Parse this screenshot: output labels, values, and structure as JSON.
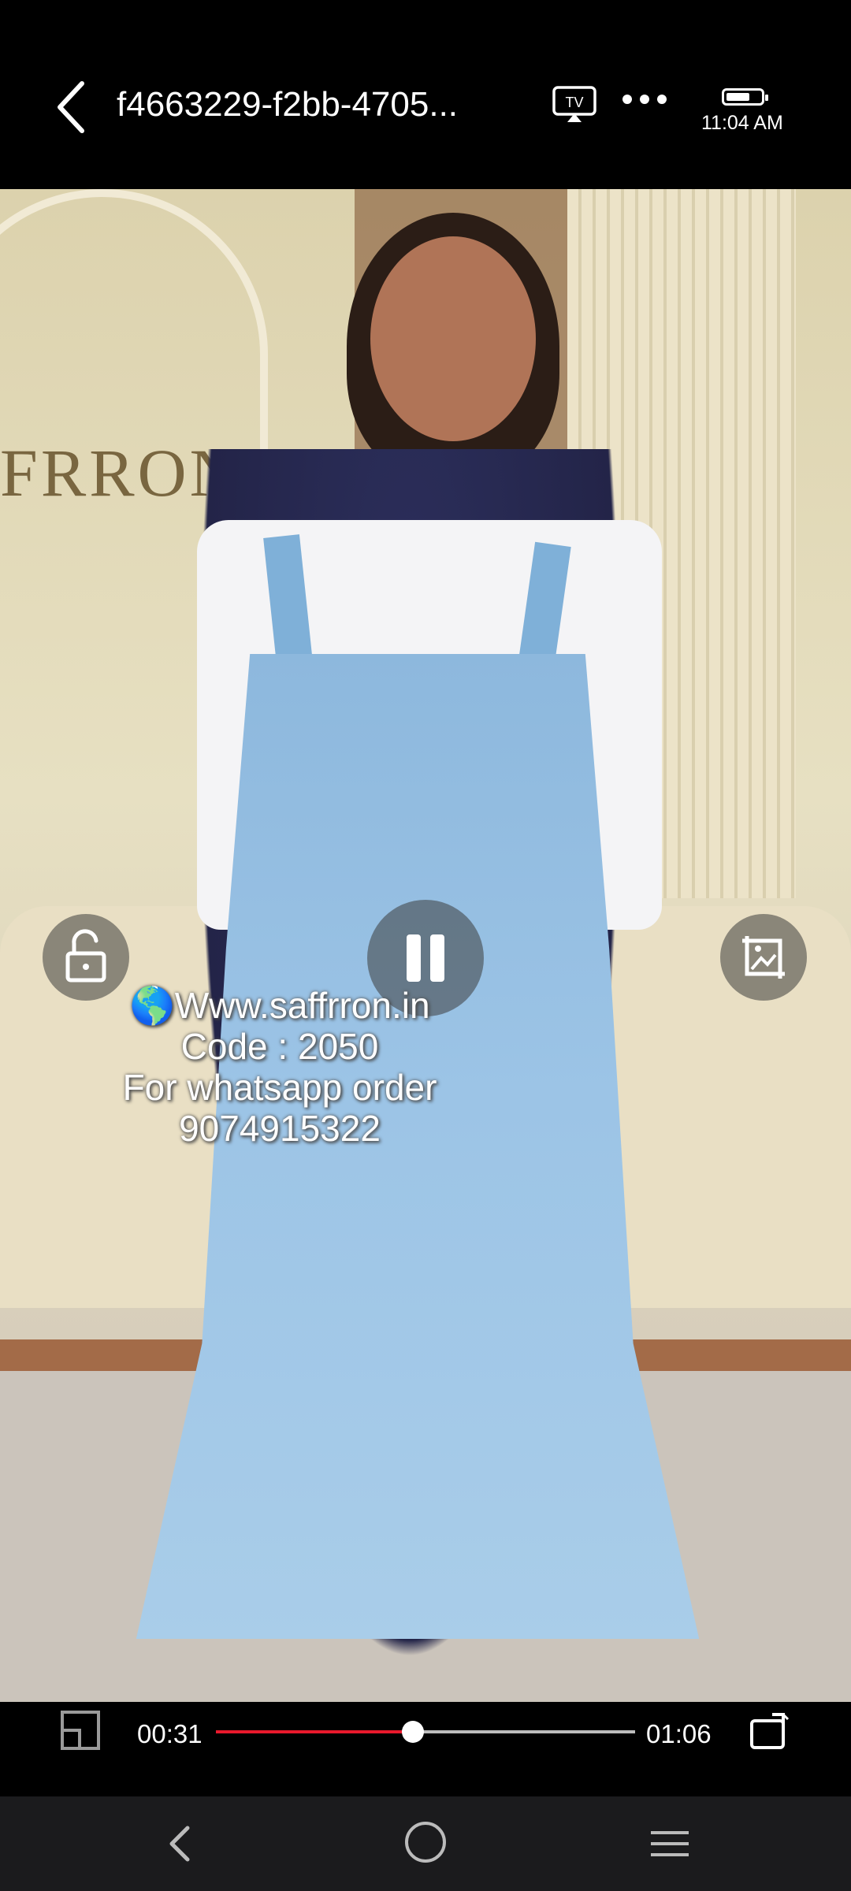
{
  "header": {
    "title": "f4663229-f2bb-4705...",
    "tv_label": "TV",
    "time": "11:04 AM",
    "battery_level": 0.65
  },
  "video": {
    "brand_text": "FRRON",
    "overlay": {
      "line1": "🌎Www.saffrron.in",
      "line2": "Code : 2050",
      "line3": "For whatsapp order",
      "line4": "9074915322"
    }
  },
  "player": {
    "current_time": "00:31",
    "total_time": "01:06",
    "progress": 0.47,
    "progress_color": "#e8192c"
  },
  "icons": [
    "back-icon",
    "cast-tv-icon",
    "more-icon",
    "battery-icon",
    "unlock-icon",
    "pause-icon",
    "crop-icon",
    "pip-icon",
    "rotate-icon",
    "nav-back-icon",
    "nav-home-icon",
    "nav-menu-icon"
  ]
}
